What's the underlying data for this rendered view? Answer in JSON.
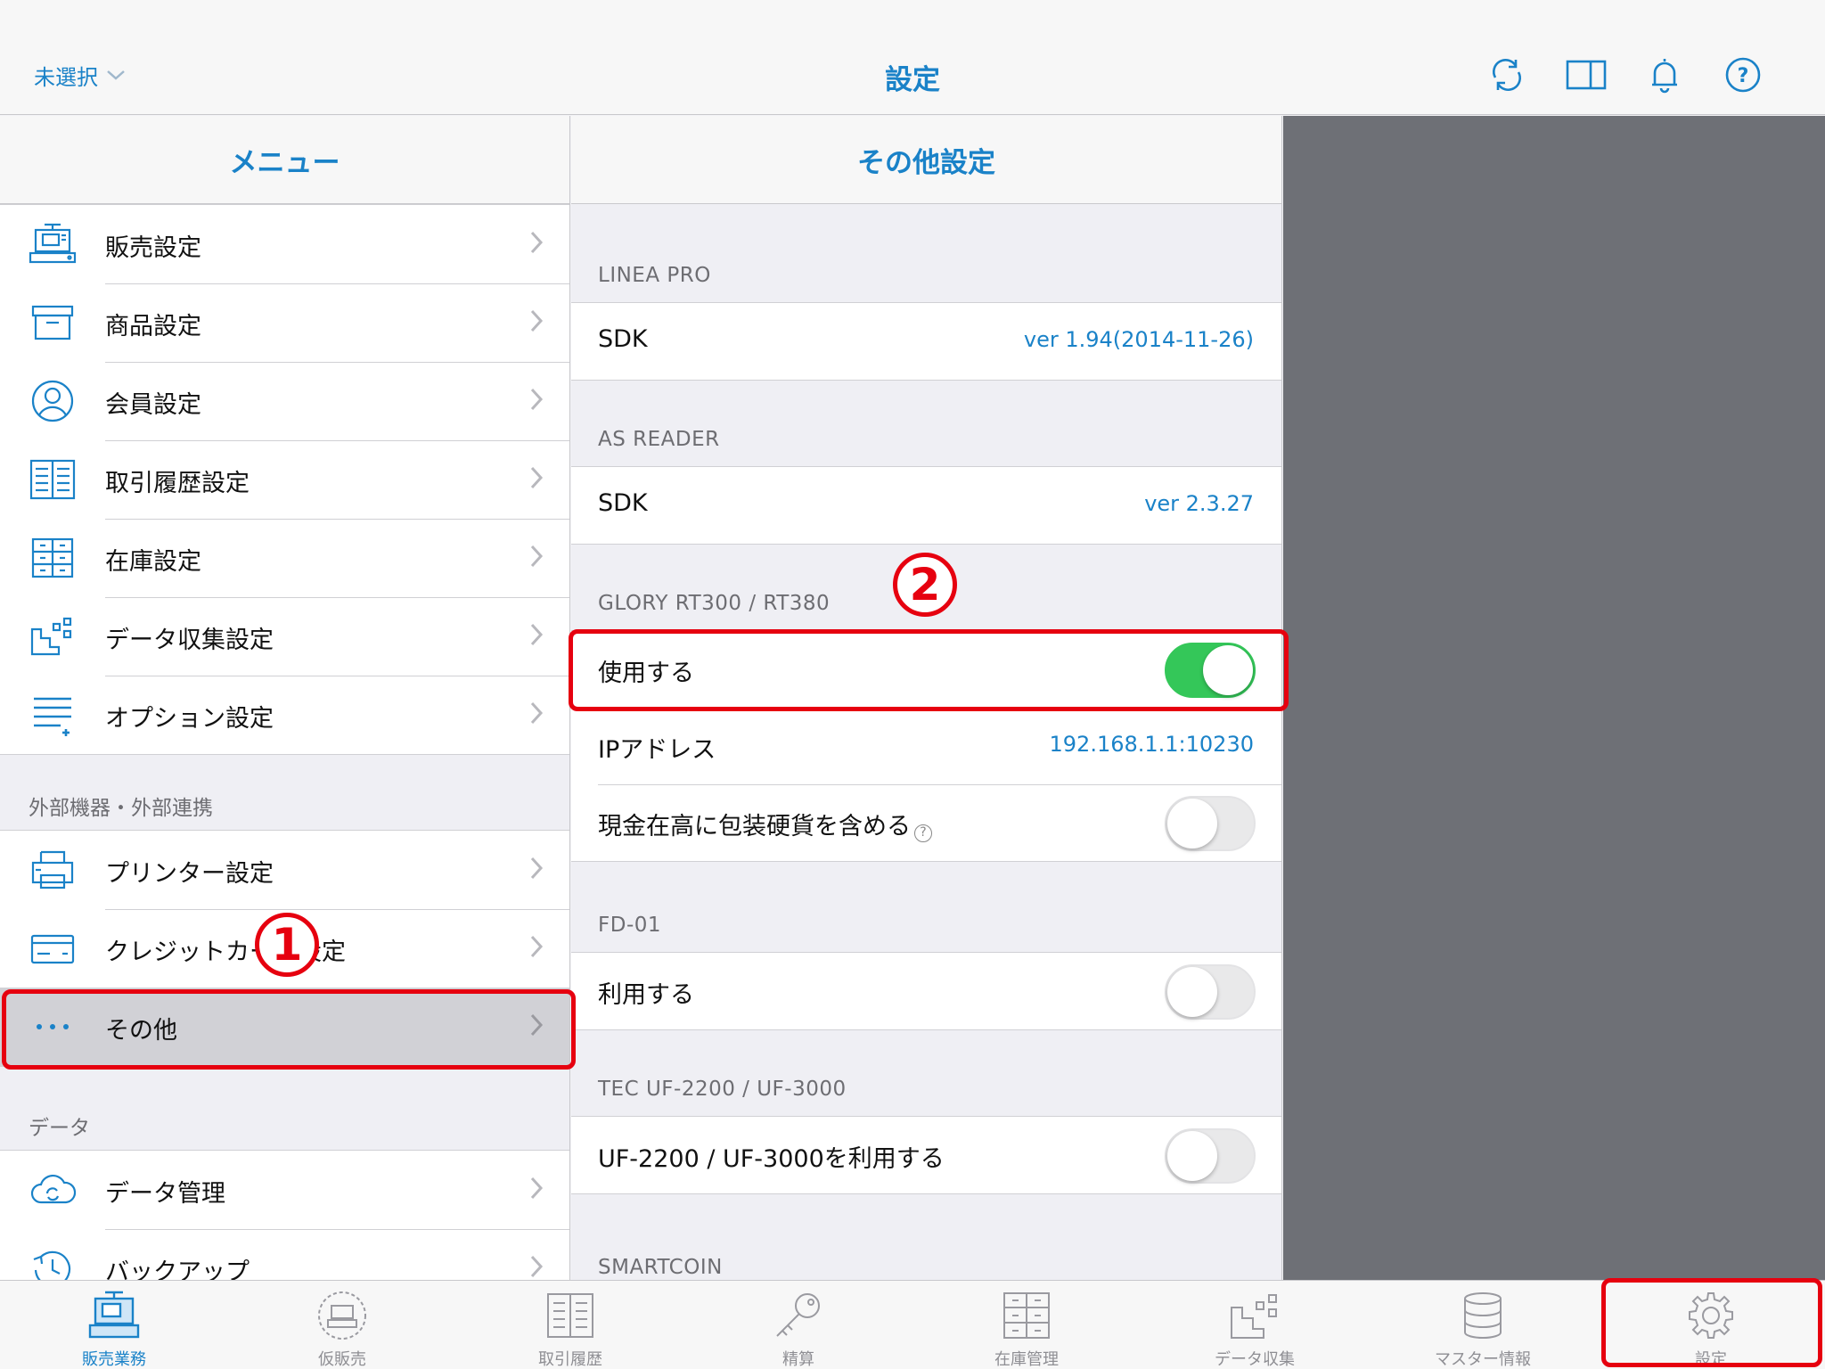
{
  "nav": {
    "store_select": "未選択",
    "title": "設定",
    "icons": [
      "sync-icon",
      "split-view-icon",
      "bell-icon",
      "help-icon"
    ]
  },
  "menu": {
    "header": "メニュー",
    "items": [
      {
        "label": "販売設定",
        "icon": "register-icon"
      },
      {
        "label": "商品設定",
        "icon": "box-icon"
      },
      {
        "label": "会員設定",
        "icon": "person-icon"
      },
      {
        "label": "取引履歴設定",
        "icon": "ledger-icon"
      },
      {
        "label": "在庫設定",
        "icon": "shelf-icon"
      },
      {
        "label": "データ収集設定",
        "icon": "data-collect-icon"
      },
      {
        "label": "オプション設定",
        "icon": "list-plus-icon"
      }
    ],
    "external_section": "外部機器・外部連携",
    "external_items": [
      {
        "label": "プリンター設定",
        "icon": "printer-icon"
      },
      {
        "label": "クレジットカード設定",
        "icon": "credit-card-icon"
      },
      {
        "label": "その他",
        "icon": "more-icon",
        "selected": true
      }
    ],
    "data_section": "データ",
    "data_items": [
      {
        "label": "データ管理",
        "icon": "cloud-sync-icon"
      },
      {
        "label": "バックアップ",
        "icon": "history-icon"
      }
    ]
  },
  "detail": {
    "header": "その他設定",
    "linea": {
      "section": "LINEA PRO",
      "sdk_label": "SDK",
      "sdk_value": "ver 1.94(2014-11-26)"
    },
    "asreader": {
      "section": "AS READER",
      "sdk_label": "SDK",
      "sdk_value": "ver 2.3.27"
    },
    "glory": {
      "section": "GLORY RT300 / RT380",
      "use_label": "使用する",
      "use_on": true,
      "ip_label": "IPアドレス",
      "ip_value": "192.168.1.1:10230",
      "wrap_label": "現金在高に包装硬貨を含める",
      "wrap_help": "?",
      "wrap_on": false
    },
    "fd01": {
      "section": "FD-01",
      "use_label": "利用する",
      "use_on": false
    },
    "tec": {
      "section": "TEC UF-2200 / UF-3000",
      "use_label": "UF-2200 / UF-3000を利用する",
      "use_on": false
    },
    "smartcoin": {
      "section": "SMARTCOIN"
    }
  },
  "tabs": [
    {
      "label": "販売業務",
      "icon": "register-icon",
      "active": true
    },
    {
      "label": "仮販売",
      "icon": "temp-sale-icon"
    },
    {
      "label": "取引履歴",
      "icon": "ledger-icon"
    },
    {
      "label": "精算",
      "icon": "key-icon"
    },
    {
      "label": "在庫管理",
      "icon": "shelf-icon"
    },
    {
      "label": "データ収集",
      "icon": "data-collect-icon"
    },
    {
      "label": "マスター情報",
      "icon": "database-icon"
    },
    {
      "label": "設定",
      "icon": "gear-icon"
    }
  ],
  "annotations": {
    "step1": "1",
    "step2": "2"
  },
  "colors": {
    "accent": "#1a82c8",
    "toggle_on": "#34c759",
    "annotation": "#e6000f",
    "dim": "#6e7076"
  }
}
